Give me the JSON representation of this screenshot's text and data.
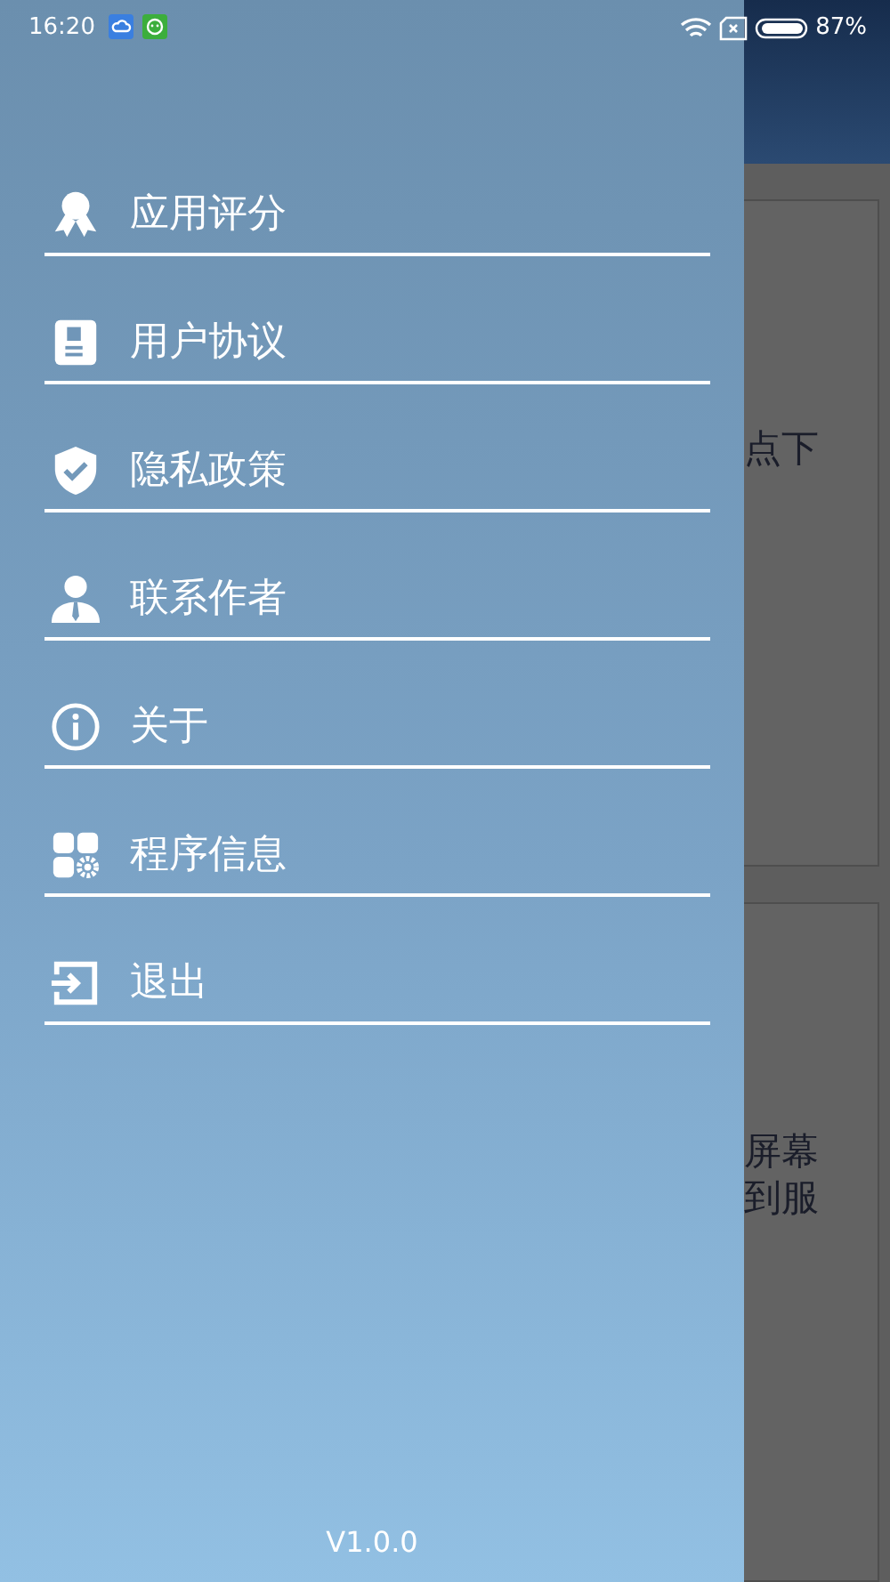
{
  "status_bar": {
    "time": "16:20",
    "battery": "87%"
  },
  "drawer": {
    "items": [
      {
        "label": "应用评分"
      },
      {
        "label": "用户协议"
      },
      {
        "label": "隐私政策"
      },
      {
        "label": "联系作者"
      },
      {
        "label": "关于"
      },
      {
        "label": "程序信息"
      },
      {
        "label": "退出"
      }
    ],
    "version": "V1.0.0"
  },
  "background_cards": [
    {
      "text_lines": [
        "点下"
      ]
    },
    {
      "text_lines": [
        "屏幕",
        "到服"
      ]
    }
  ]
}
